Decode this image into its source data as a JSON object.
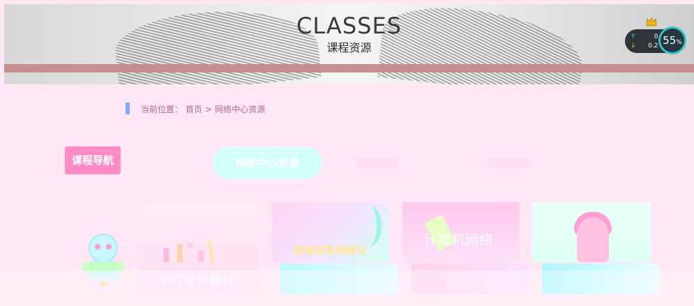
{
  "banner": {
    "title": "CLASSES",
    "subtitle": "课程资源"
  },
  "speed_widget": {
    "upload": "0 K/s",
    "download": "0.2 K/s",
    "percent": "55",
    "percent_unit": "%"
  },
  "breadcrumb": {
    "label": "当前位置：",
    "home": "首页",
    "separator": ">",
    "current": "网络中心资源"
  },
  "course_nav": {
    "label": "课程导航"
  },
  "tabs": {
    "active": "网络中心资源"
  },
  "cards": [
    {
      "caption": "PPT设计教程"
    },
    {
      "caption": "数据库系统概论"
    },
    {
      "caption": "计算机网络"
    },
    {
      "caption": ""
    }
  ],
  "colors": {
    "accent_pink": "#ff8cc7",
    "tab_active": "#d2fff7",
    "breadcrumb_bar": "#82a9ff",
    "page_background": "#ffe8f4"
  }
}
